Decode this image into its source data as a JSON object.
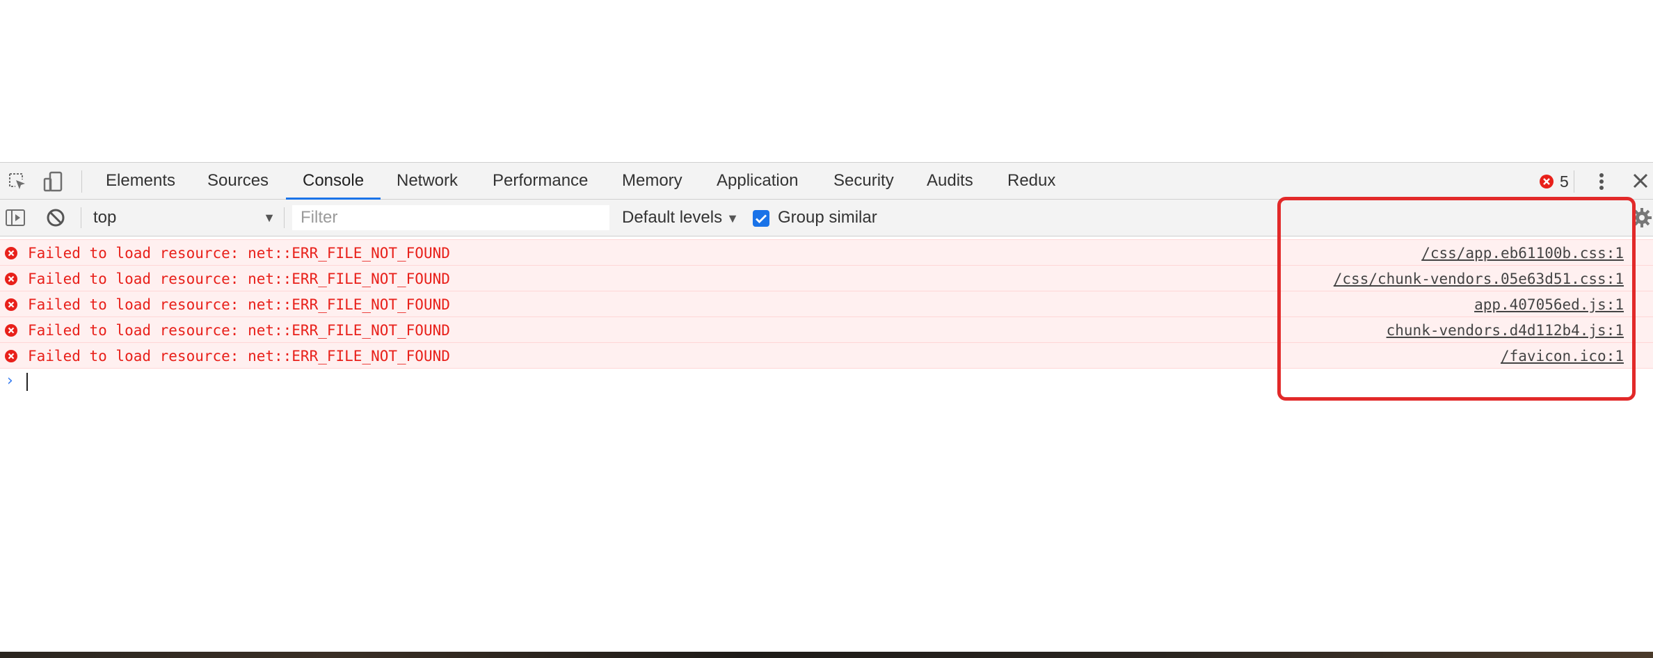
{
  "tabs": [
    "Elements",
    "Sources",
    "Console",
    "Network",
    "Performance",
    "Memory",
    "Application",
    "Security",
    "Audits",
    "Redux"
  ],
  "active_tab": "Console",
  "error_count": "5",
  "toolbar": {
    "context": "top",
    "filter_placeholder": "Filter",
    "levels_label": "Default levels",
    "group_similar_label": "Group similar",
    "group_similar_checked": true
  },
  "messages": [
    {
      "text": "Failed to load resource: net::ERR_FILE_NOT_FOUND",
      "source": "/css/app.eb61100b.css:1"
    },
    {
      "text": "Failed to load resource: net::ERR_FILE_NOT_FOUND",
      "source": "/css/chunk-vendors.05e63d51.css:1"
    },
    {
      "text": "Failed to load resource: net::ERR_FILE_NOT_FOUND",
      "source": "app.407056ed.js:1"
    },
    {
      "text": "Failed to load resource: net::ERR_FILE_NOT_FOUND",
      "source": "chunk-vendors.d4d112b4.js:1"
    },
    {
      "text": "Failed to load resource: net::ERR_FILE_NOT_FOUND",
      "source": "/favicon.ico:1"
    }
  ],
  "colors": {
    "error_text": "#e8201a",
    "error_bg": "#fff0f0",
    "active_tab_accent": "#1a73e8",
    "highlight_border": "#e22929"
  }
}
